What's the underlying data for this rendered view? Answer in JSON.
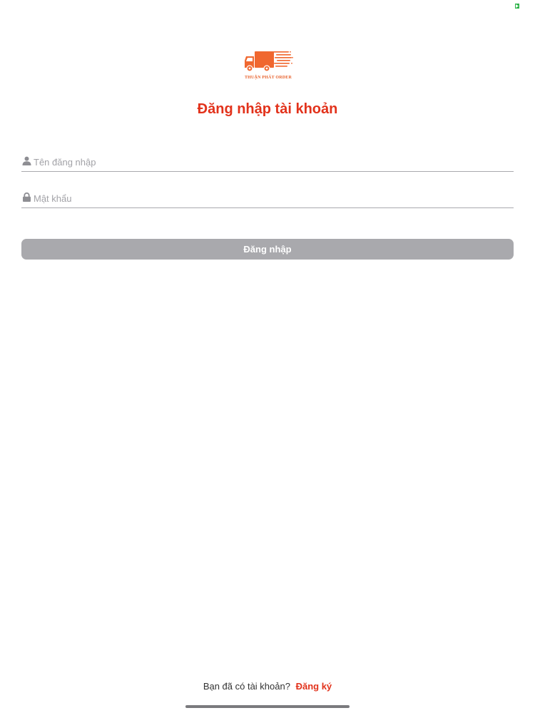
{
  "status_indicator": {
    "color": "#2fb34a"
  },
  "logo": {
    "brand_text": "THUẬN PHÁT ORDER",
    "icon": "delivery-truck-icon",
    "color": "#f0672f"
  },
  "title": "Đăng nhập tài khoản",
  "username_field": {
    "icon": "user-icon",
    "placeholder": "Tên đăng nhập",
    "value": ""
  },
  "password_field": {
    "icon": "lock-icon",
    "placeholder": "Mật khẩu",
    "value": ""
  },
  "login_button": {
    "label": "Đăng nhập",
    "background": "#a9a9ad"
  },
  "signup": {
    "prompt": "Bạn đã có tài khoản?",
    "link_label": "Đăng ký"
  },
  "colors": {
    "accent": "#e2321b",
    "field_underline": "#a9a9ae",
    "placeholder": "#a2a2a7"
  }
}
